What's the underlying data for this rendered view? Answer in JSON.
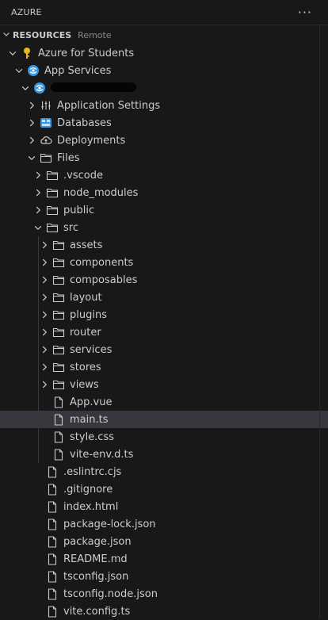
{
  "panel": {
    "title": "AZURE",
    "more_icon": "ellipsis-icon"
  },
  "section": {
    "title": "RESOURCES",
    "badge": "Remote"
  },
  "tree": [
    {
      "label": "Azure for Students",
      "depth": 1,
      "chev": "down",
      "icon": "key"
    },
    {
      "label": "App Services",
      "depth": 2,
      "chev": "down",
      "icon": "appservice"
    },
    {
      "label": "",
      "depth": 3,
      "chev": "down",
      "icon": "appservice",
      "redacted": true
    },
    {
      "label": "Application Settings",
      "depth": 4,
      "chev": "right",
      "icon": "settings"
    },
    {
      "label": "Databases",
      "depth": 4,
      "chev": "right",
      "icon": "database"
    },
    {
      "label": "Deployments",
      "depth": 4,
      "chev": "right",
      "icon": "cloud"
    },
    {
      "label": "Files",
      "depth": 4,
      "chev": "down",
      "icon": "folder"
    },
    {
      "label": ".vscode",
      "depth": 5,
      "chev": "right",
      "icon": "folder"
    },
    {
      "label": "node_modules",
      "depth": 5,
      "chev": "right",
      "icon": "folder"
    },
    {
      "label": "public",
      "depth": 5,
      "chev": "right",
      "icon": "folder"
    },
    {
      "label": "src",
      "depth": 5,
      "chev": "down",
      "icon": "folder"
    },
    {
      "label": "assets",
      "depth": 6,
      "chev": "right",
      "icon": "folder"
    },
    {
      "label": "components",
      "depth": 6,
      "chev": "right",
      "icon": "folder"
    },
    {
      "label": "composables",
      "depth": 6,
      "chev": "right",
      "icon": "folder"
    },
    {
      "label": "layout",
      "depth": 6,
      "chev": "right",
      "icon": "folder"
    },
    {
      "label": "plugins",
      "depth": 6,
      "chev": "right",
      "icon": "folder"
    },
    {
      "label": "router",
      "depth": 6,
      "chev": "right",
      "icon": "folder"
    },
    {
      "label": "services",
      "depth": 6,
      "chev": "right",
      "icon": "folder"
    },
    {
      "label": "stores",
      "depth": 6,
      "chev": "right",
      "icon": "folder"
    },
    {
      "label": "views",
      "depth": 6,
      "chev": "right",
      "icon": "folder"
    },
    {
      "label": "App.vue",
      "depth": 6,
      "chev": "none",
      "icon": "file"
    },
    {
      "label": "main.ts",
      "depth": 6,
      "chev": "none",
      "icon": "file",
      "selected": true
    },
    {
      "label": "style.css",
      "depth": 6,
      "chev": "none",
      "icon": "file"
    },
    {
      "label": "vite-env.d.ts",
      "depth": 6,
      "chev": "none",
      "icon": "file"
    },
    {
      "label": ".eslintrc.cjs",
      "depth": 5,
      "chev": "none",
      "icon": "file"
    },
    {
      "label": ".gitignore",
      "depth": 5,
      "chev": "none",
      "icon": "file"
    },
    {
      "label": "index.html",
      "depth": 5,
      "chev": "none",
      "icon": "file"
    },
    {
      "label": "package-lock.json",
      "depth": 5,
      "chev": "none",
      "icon": "file"
    },
    {
      "label": "package.json",
      "depth": 5,
      "chev": "none",
      "icon": "file"
    },
    {
      "label": "README.md",
      "depth": 5,
      "chev": "none",
      "icon": "file"
    },
    {
      "label": "tsconfig.json",
      "depth": 5,
      "chev": "none",
      "icon": "file"
    },
    {
      "label": "tsconfig.node.json",
      "depth": 5,
      "chev": "none",
      "icon": "file"
    },
    {
      "label": "vite.config.ts",
      "depth": 5,
      "chev": "none",
      "icon": "file"
    }
  ],
  "colors": {
    "background": "#181818",
    "text": "#cccccc",
    "selected": "#37373d",
    "key": "#e8b81f",
    "azure": "#3a96dd"
  }
}
